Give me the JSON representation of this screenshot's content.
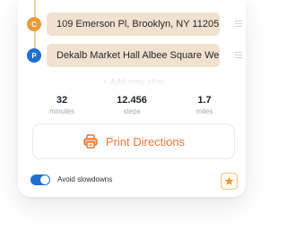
{
  "stops": [
    {
      "marker": "C",
      "address": "109 Emerson Pl, Brooklyn, NY 11205",
      "color": "#eb9a3c"
    },
    {
      "marker": "P",
      "address": "Dekalb Market Hall Albee Square We...",
      "color": "#1e6fcf"
    }
  ],
  "add_stop_label": "+ Add new stop",
  "stats": [
    {
      "value": "32",
      "unit": "minutes"
    },
    {
      "value": "12.456",
      "unit": "steps"
    },
    {
      "value": "1.7",
      "unit": "miles"
    }
  ],
  "print_label": "Print Directions",
  "avoid_slowdowns": {
    "label": "Avoid slowdowns",
    "enabled": true
  },
  "colors": {
    "accent": "#ea7a3a",
    "primary": "#1e6fcf",
    "stop_fill": "#f1e1cf"
  },
  "icons": {
    "print": "printer-icon",
    "favorite": "star-icon",
    "drag": "drag-handle-icon"
  }
}
